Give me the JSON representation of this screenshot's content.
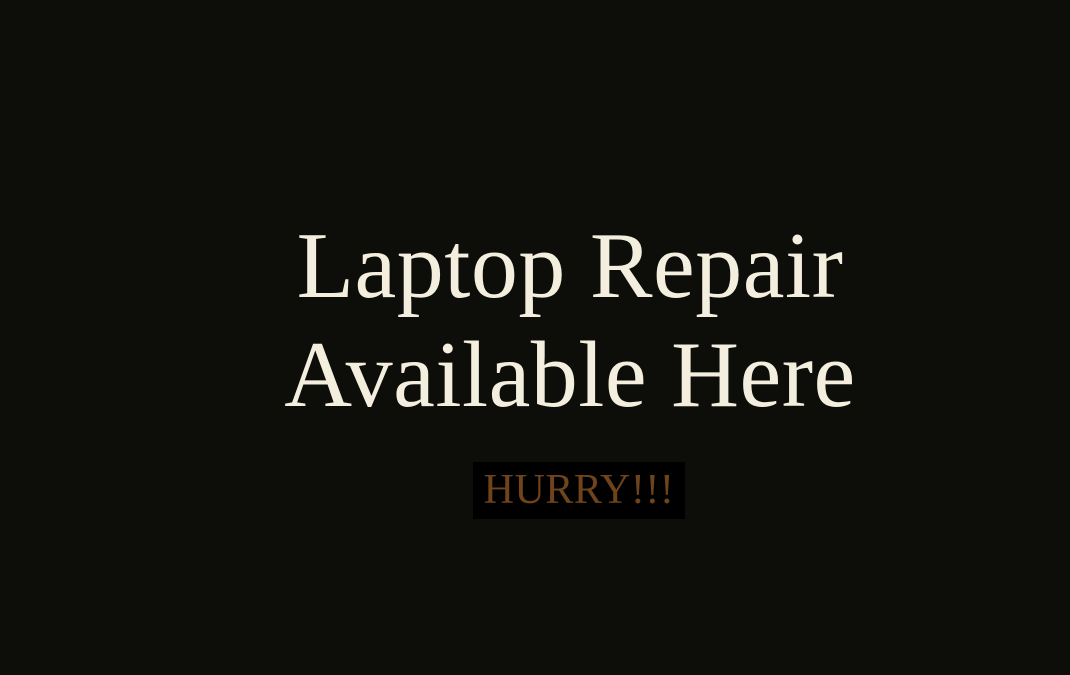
{
  "headline": {
    "line1": "Laptop Repair",
    "line2": "Available Here"
  },
  "cta": {
    "text": "HURRY!!!"
  },
  "colors": {
    "background": "#0d0d09",
    "headline": "#f3eedd",
    "cta_text": "#6f431c",
    "cta_background": "#000000"
  }
}
